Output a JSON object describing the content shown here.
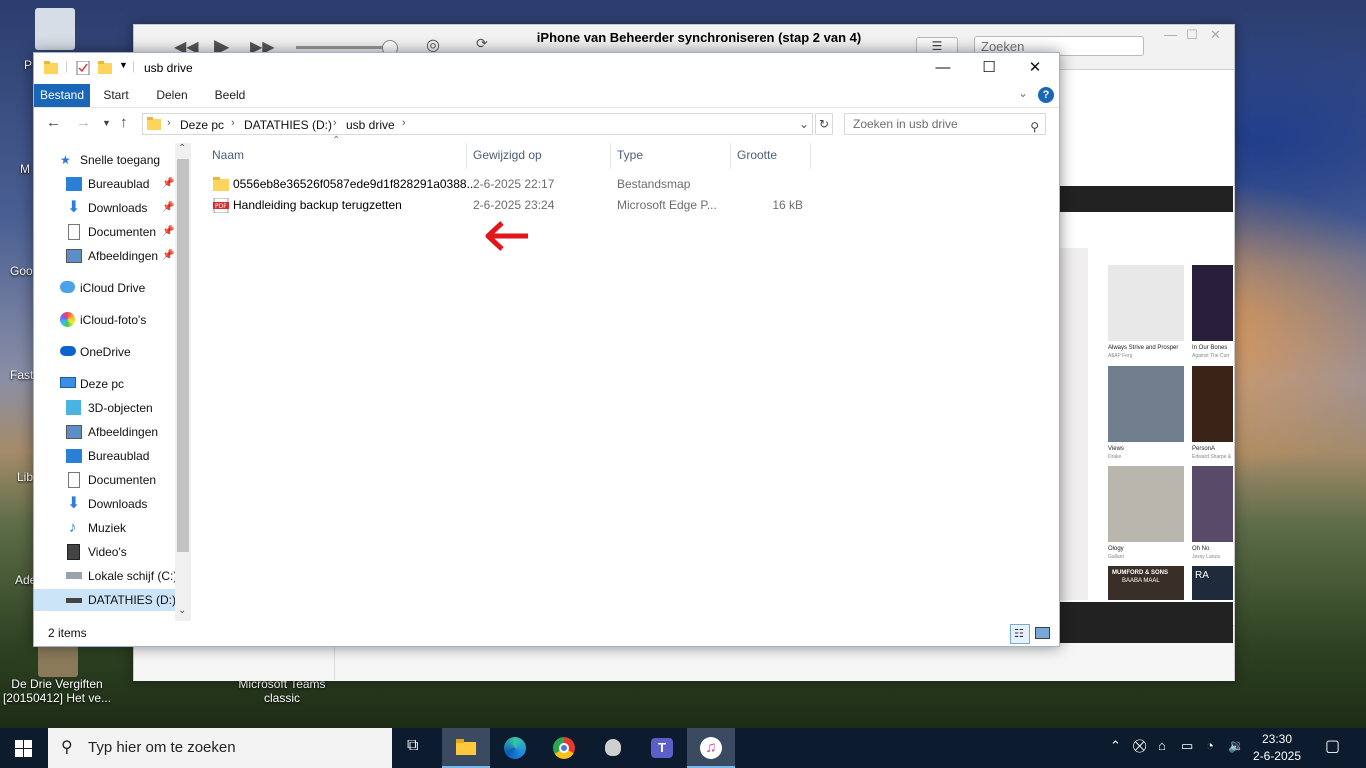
{
  "desktop": {
    "icons": [
      {
        "label": "P"
      },
      {
        "label": "M"
      },
      {
        "label": "Goo"
      },
      {
        "label": "Fast"
      },
      {
        "label": "Lib"
      },
      {
        "label": "Ade"
      },
      {
        "label": "De Drie Vergiften [20150412] Het ve..."
      },
      {
        "label": "Microsoft Teams classic"
      }
    ]
  },
  "itunes": {
    "title": "iPhone van Beheerder synchroniseren (stap 2 van 4)",
    "search_placeholder": "Zoeken",
    "albums": [
      {
        "title": "Always Strive and Prosper",
        "artist": "A$AP Ferg",
        "color": "#e8e8e8"
      },
      {
        "title": "In Our Bones",
        "artist": "Against The Curr",
        "color": "#2a1f3a"
      },
      {
        "title": "Views",
        "artist": "Drake",
        "color": "#6f7d8c"
      },
      {
        "title": "PersonA",
        "artist": "Edward Sharpe &",
        "color": "#3a2418"
      },
      {
        "title": "Ology",
        "artist": "Gallant",
        "color": "#b9b6ae"
      },
      {
        "title": "Oh No",
        "artist": "Jessy Lanza",
        "color": "#5a4a6a"
      },
      {
        "title": "MUMFORD & SONS",
        "artist": "BAABA MAAL",
        "color": "#3a2f28"
      },
      {
        "title": "RA",
        "artist": "",
        "color": "#1f2a3a"
      }
    ]
  },
  "explorer": {
    "title": "usb drive",
    "ribbon_tabs": [
      "Bestand",
      "Start",
      "Delen",
      "Beeld"
    ],
    "breadcrumb": [
      "Deze pc",
      "DATATHIES (D:)",
      "usb drive"
    ],
    "search_placeholder": "Zoeken in usb drive",
    "nav": {
      "quick_access": "Snelle toegang",
      "pinned": [
        "Bureaublad",
        "Downloads",
        "Documenten",
        "Afbeeldingen"
      ],
      "icloud_drive": "iCloud Drive",
      "icloud_photos": "iCloud-foto's",
      "onedrive": "OneDrive",
      "this_pc": "Deze pc",
      "pc_items": [
        "3D-objecten",
        "Afbeeldingen",
        "Bureaublad",
        "Documenten",
        "Downloads",
        "Muziek",
        "Video's",
        "Lokale schijf (C:)",
        "DATATHIES (D:)"
      ]
    },
    "columns": [
      "Naam",
      "Gewijzigd op",
      "Type",
      "Grootte"
    ],
    "files": [
      {
        "name": "0556eb8e36526f0587ede9d1f828291a0388...",
        "modified": "2-6-2025 22:17",
        "type": "Bestandsmap",
        "size": ""
      },
      {
        "name": "Handleiding backup terugzetten",
        "modified": "2-6-2025 23:24",
        "type": "Microsoft Edge P...",
        "size": "16 kB"
      }
    ],
    "status": "2 items"
  },
  "taskbar": {
    "search_placeholder": "Typ hier om te zoeken",
    "time": "23:30",
    "date": "2-6-2025"
  },
  "colors": {
    "accent": "#1a67b8",
    "arrow": "#e3161b",
    "taskbar": "#0d1b2e"
  }
}
